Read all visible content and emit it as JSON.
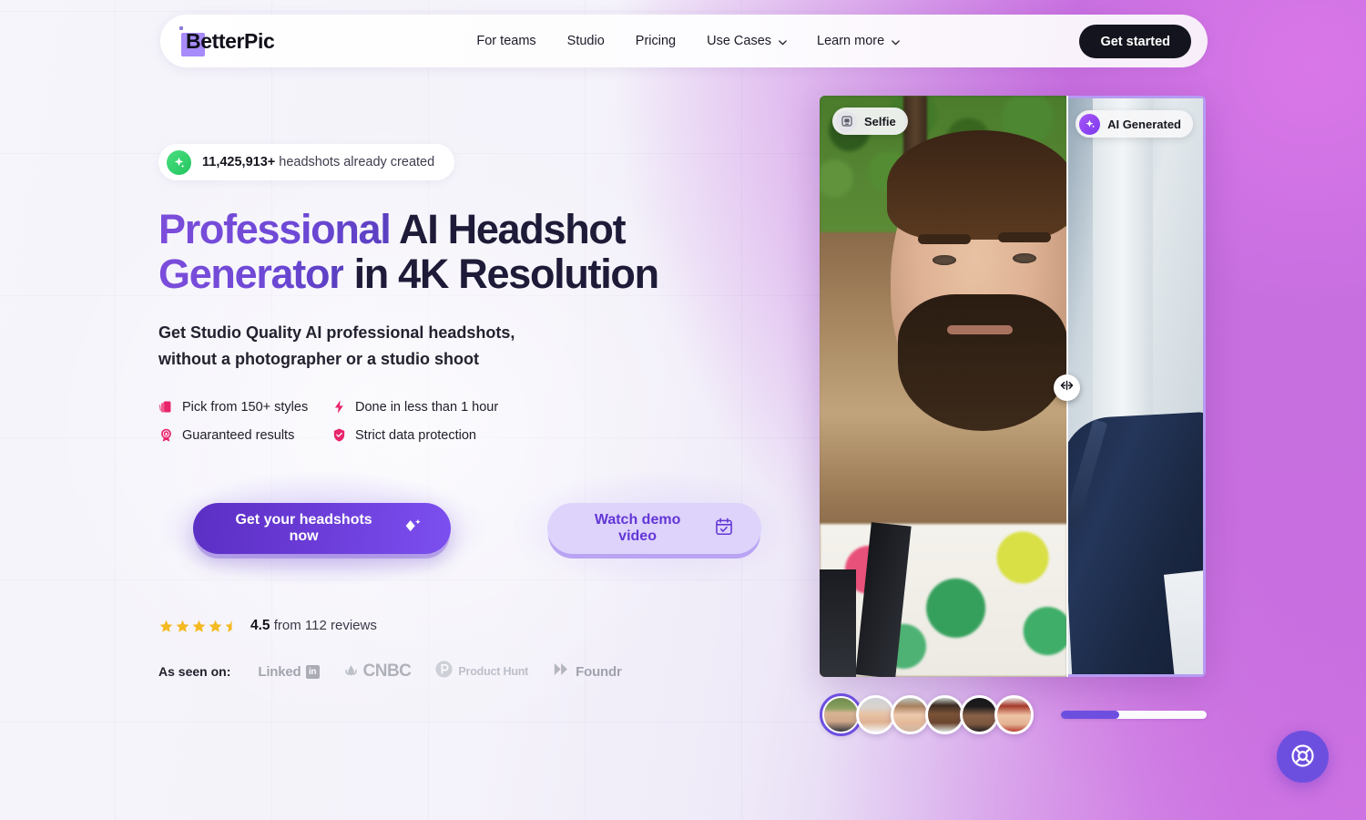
{
  "nav": {
    "logo": "BetterPic",
    "links": [
      {
        "label": "For teams",
        "has_chevron": false
      },
      {
        "label": "Studio",
        "has_chevron": false
      },
      {
        "label": "Pricing",
        "has_chevron": false
      },
      {
        "label": "Use Cases",
        "has_chevron": true
      },
      {
        "label": "Learn more",
        "has_chevron": true
      }
    ],
    "cta": "Get started"
  },
  "hero": {
    "badge": {
      "count": "11,425,913+",
      "text": "headshots already created",
      "icon": "sparkle-icon"
    },
    "headline_line1_accent": "Professional",
    "headline_line1_rest": " AI Headshot",
    "headline_line2_accent": "Generator",
    "headline_line2_rest": " in 4K Resolution",
    "subtitle_line1": "Get Studio Quality AI professional headshots,",
    "subtitle_line2": "without a photographer or a studio shoot",
    "features": [
      {
        "label": "Pick from 150+ styles",
        "icon": "cards-icon"
      },
      {
        "label": "Done in less than 1 hour",
        "icon": "lightning-icon"
      },
      {
        "label": "Guaranteed results",
        "icon": "award-badge-icon"
      },
      {
        "label": "Strict data protection",
        "icon": "shield-check-icon"
      }
    ],
    "primary_cta": "Get your headshots now",
    "primary_cta_icon": "sparkle-diamond-icon",
    "secondary_cta": "Watch demo video",
    "secondary_cta_icon": "calendar-check-icon",
    "rating_value": "4.5",
    "rating_text": "from 112 reviews",
    "rating_stars": 4.5,
    "press_label": "As seen on:",
    "press": [
      {
        "name": "Linked",
        "mark": "in"
      },
      {
        "name": "CNBC"
      },
      {
        "name": "Product Hunt"
      },
      {
        "name": "Foundr"
      }
    ]
  },
  "compare": {
    "before_badge": "Selfie",
    "before_badge_icon": "photo-icon",
    "after_badge": "AI Generated",
    "after_badge_icon": "sparkle-icon",
    "slider_icon": "left-right-arrows-icon",
    "progress_percent": 40,
    "thumbnails": [
      {
        "name": "avatar-1",
        "selected": true
      },
      {
        "name": "avatar-2",
        "selected": false
      },
      {
        "name": "avatar-3",
        "selected": false
      },
      {
        "name": "avatar-4",
        "selected": false
      },
      {
        "name": "avatar-5",
        "selected": false
      },
      {
        "name": "avatar-6",
        "selected": false
      }
    ]
  },
  "support": {
    "icon": "lifebuoy-icon",
    "label": "Support"
  },
  "colors": {
    "brand_purple": "#6d4fe0",
    "accent_gradient_start": "#7c4ddb",
    "dark": "#14141f",
    "green_badge": "#22c55e",
    "pink_icon": "#e8246b",
    "star_yellow": "#f5b921"
  }
}
